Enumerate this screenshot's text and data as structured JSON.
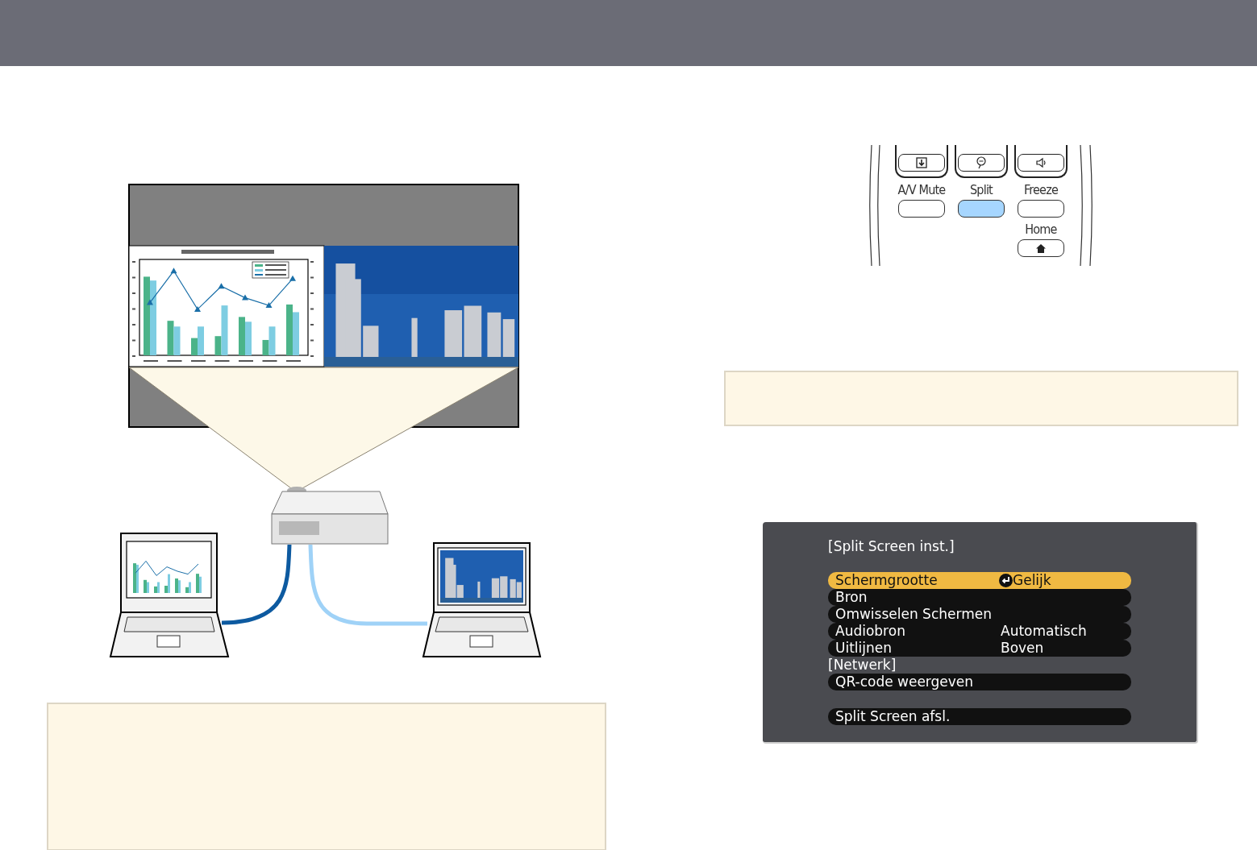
{
  "remote": {
    "keys": [
      {
        "label": "A/V Mute",
        "selected": false
      },
      {
        "label": "Split",
        "selected": true
      },
      {
        "label": "Freeze",
        "selected": false
      }
    ],
    "home": {
      "label": "Home"
    }
  },
  "menu": {
    "title": "[Split Screen inst.]",
    "rows": [
      {
        "kind": "item",
        "label": "Schermgrootte",
        "value": "Gelijk",
        "enter": true,
        "selected": true
      },
      {
        "kind": "item",
        "label": "Bron",
        "enter": false,
        "selected": false
      },
      {
        "kind": "item",
        "label": "Omwisselen Schermen",
        "enter": false,
        "selected": false
      },
      {
        "kind": "item",
        "label": "Audiobron",
        "value": "Automatisch",
        "enter": false,
        "selected": false
      },
      {
        "kind": "item",
        "label": "Uitlijnen",
        "value": "Boven",
        "enter": false,
        "selected": false
      },
      {
        "kind": "heading",
        "label": "[Netwerk]"
      },
      {
        "kind": "item",
        "label": "QR-code weergeven",
        "enter": false,
        "selected": false
      }
    ],
    "exit_row": {
      "label": "Split Screen afsl.",
      "selected": false
    }
  }
}
